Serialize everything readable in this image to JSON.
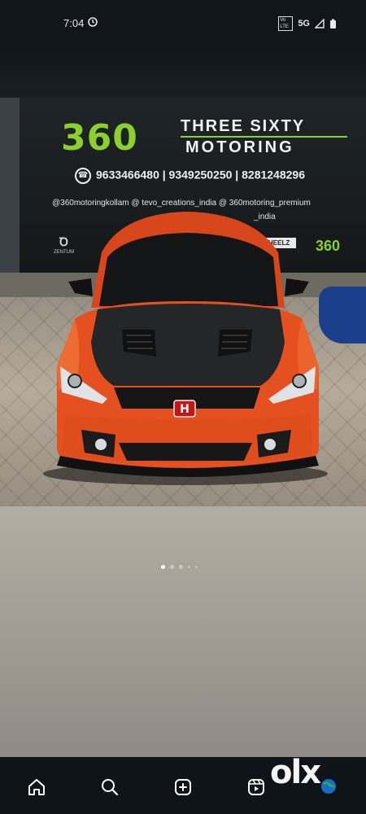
{
  "status_bar": {
    "time": "7:04",
    "network": "5G",
    "volte": "Vo LTE"
  },
  "photo": {
    "banner": {
      "brand_number": "360",
      "brand_line1": "THREE SIXTY",
      "brand_line2": "MOTORING",
      "phones": "9633466480  | 9349250250 | 8281248296",
      "handles": "@360motoringkollam   @ tevo_creations_india   @ 360motoring_premium",
      "handles_line2": "_india",
      "sponsor_left": "ZENTUM",
      "sponsor_mid": "HEELZ",
      "sponsor_right": "360",
      "accent_color": "#8bd02c"
    },
    "carousel": {
      "total_dots": 5,
      "active_index": 0
    }
  },
  "bottom_nav": {
    "items": [
      {
        "name": "home",
        "icon": "home-icon"
      },
      {
        "name": "search",
        "icon": "search-icon"
      },
      {
        "name": "create",
        "icon": "plus-square-icon"
      },
      {
        "name": "reels",
        "icon": "reels-icon"
      }
    ],
    "watermark": "olx"
  }
}
